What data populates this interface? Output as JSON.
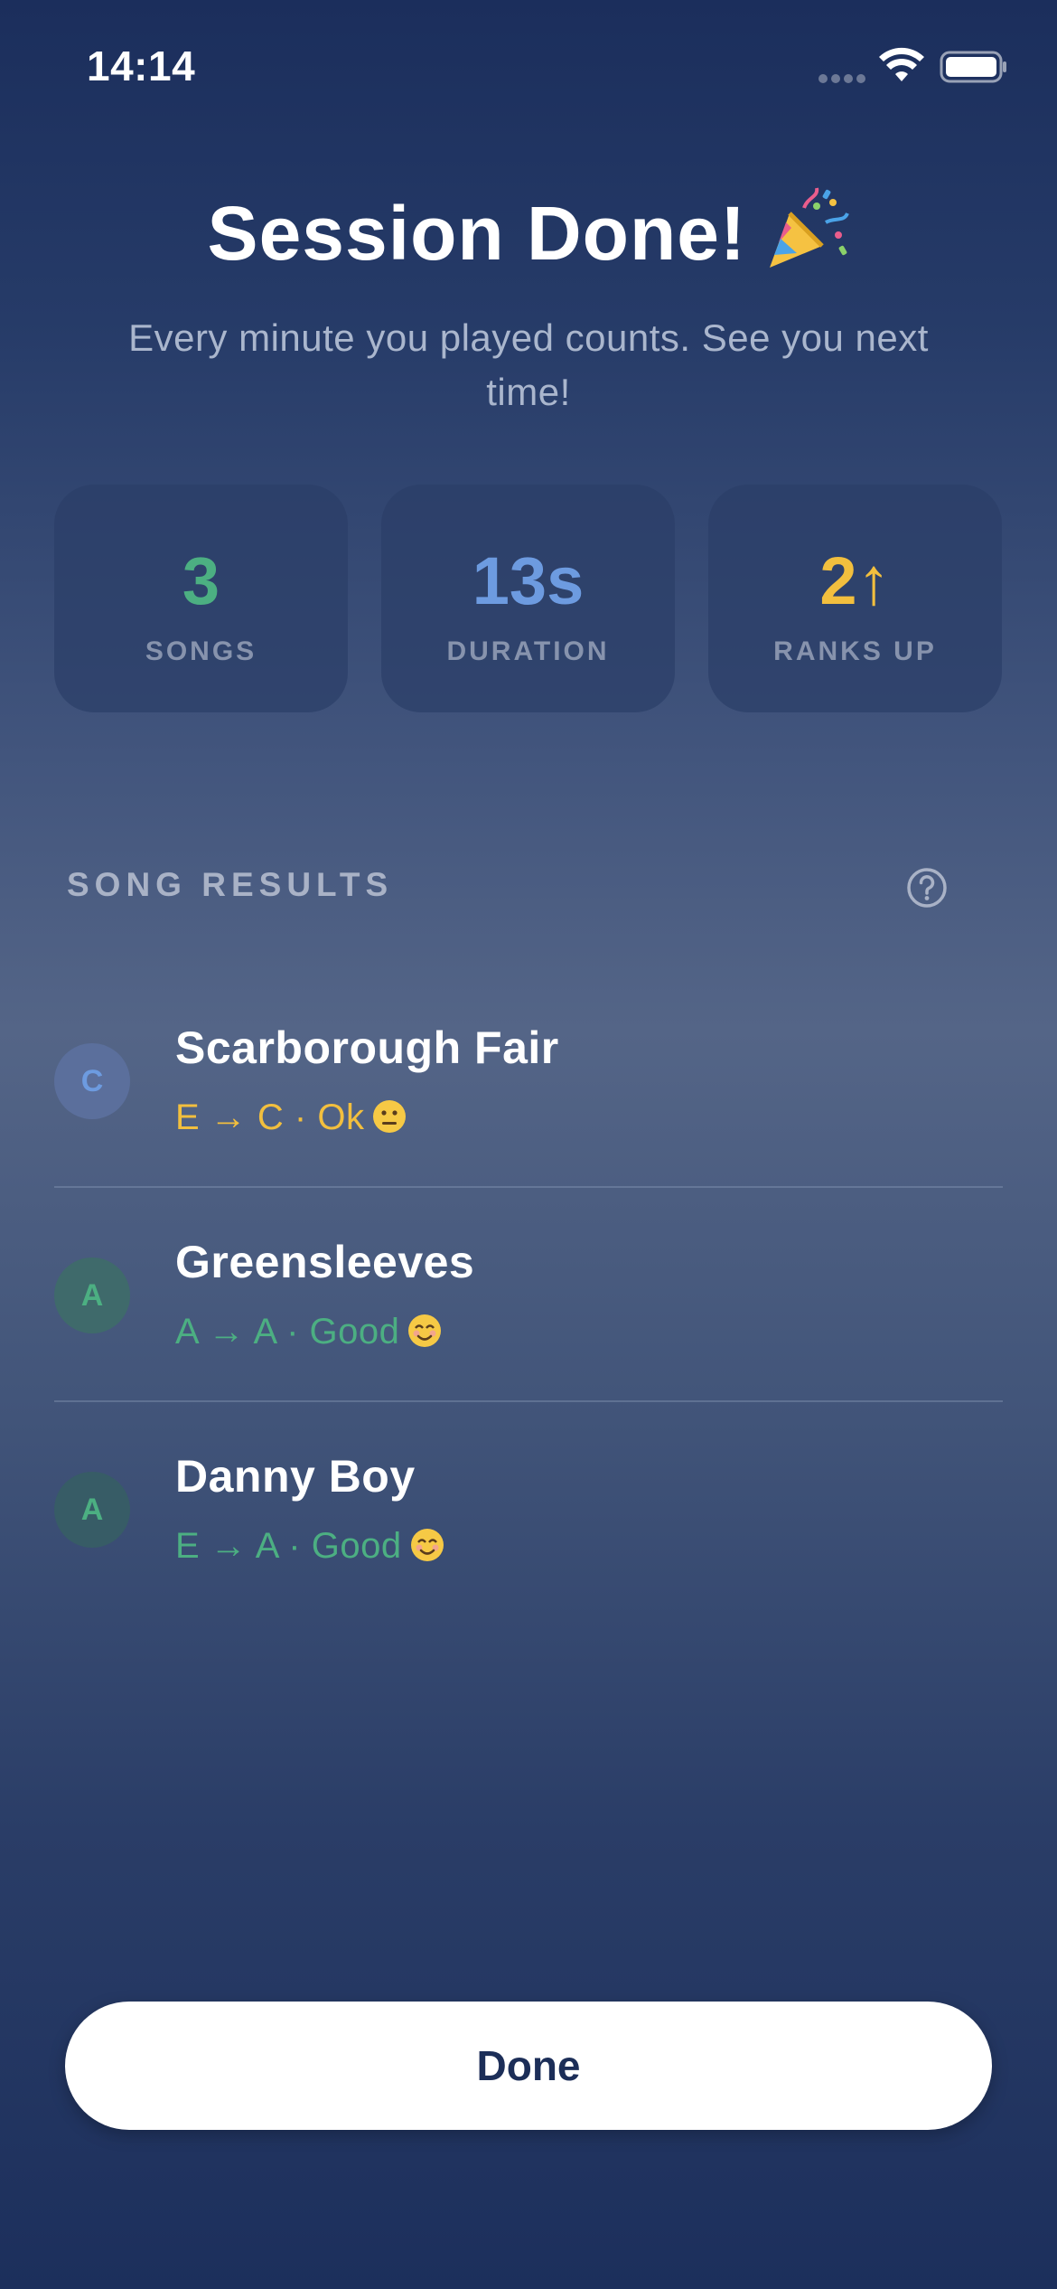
{
  "status_bar": {
    "time": "14:14"
  },
  "header": {
    "title": "Session Done!",
    "title_icon": "party-popper-icon",
    "subtitle": "Every minute you played counts. See you next time!"
  },
  "stats": [
    {
      "value": "3",
      "label": "SONGS",
      "color": "#4caf82"
    },
    {
      "value": "13s",
      "label": "DURATION",
      "color": "#6d9be0"
    },
    {
      "value": "2↑",
      "label": "RANKS UP",
      "color": "#f2bf3e"
    }
  ],
  "results": {
    "heading": "SONG RESULTS",
    "help_icon": "question-circle-icon",
    "songs": [
      {
        "initial": "C",
        "title": "Scarborough Fair",
        "detail": "E → C · Ok",
        "emoji": "neutral-face-icon",
        "accent": "#f2bf3e",
        "avatar_text": "#6d9be0",
        "avatar_bg": "#5b6f9c"
      },
      {
        "initial": "A",
        "title": "Greensleeves",
        "detail": "A → A · Good",
        "emoji": "smiling-face-icon",
        "accent": "#4caf82",
        "avatar_text": "#4caf82",
        "avatar_bg": "#3f6a6b"
      },
      {
        "initial": "A",
        "title": "Danny Boy",
        "detail": "E → A · Good",
        "emoji": "smiling-face-icon",
        "accent": "#4caf82",
        "avatar_text": "#4caf82",
        "avatar_bg": "#375c66"
      }
    ]
  },
  "footer": {
    "done_label": "Done"
  }
}
